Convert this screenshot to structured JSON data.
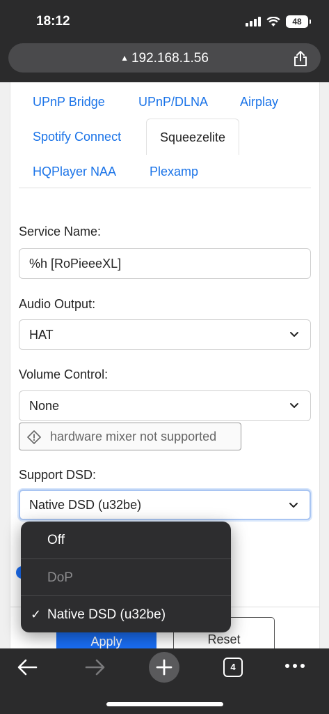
{
  "status_bar": {
    "time": "18:12",
    "battery": "48",
    "icons": [
      "signal-icon",
      "wifi-icon",
      "battery-icon"
    ]
  },
  "browser": {
    "url": "192.168.1.56",
    "url_warning_icon": "warning-icon",
    "share_icon": "share-icon"
  },
  "tabs": [
    {
      "label": "UPnP Bridge"
    },
    {
      "label": "UPnP/DLNA"
    },
    {
      "label": "Airplay"
    },
    {
      "label": "Spotify Connect"
    },
    {
      "label": "Squeezelite",
      "active": true
    },
    {
      "label": "HQPlayer NAA"
    },
    {
      "label": "Plexamp"
    }
  ],
  "form": {
    "service_name": {
      "label": "Service Name:",
      "value": "%h [RoPieeeXL]"
    },
    "audio_output": {
      "label": "Audio Output:",
      "value": "HAT"
    },
    "volume_control": {
      "label": "Volume Control:",
      "value": "None",
      "warning": "hardware mixer not supported"
    },
    "support_dsd": {
      "label": "Support DSD:",
      "value": "Native DSD (u32be)"
    },
    "apply_label": "Apply",
    "reset_label": "Reset"
  },
  "dropdown": {
    "options": [
      {
        "label": "Off",
        "disabled": false,
        "selected": false
      },
      {
        "label": "DoP",
        "disabled": true,
        "selected": false
      },
      {
        "label": "Native DSD (u32be)",
        "disabled": false,
        "selected": true
      }
    ],
    "check_mark": "✓"
  },
  "toolbar": {
    "tab_count": "4"
  },
  "colors": {
    "accent": "#1a73e8",
    "button_primary": "#1a6ef5",
    "chrome_bg": "#2b2b2c"
  }
}
